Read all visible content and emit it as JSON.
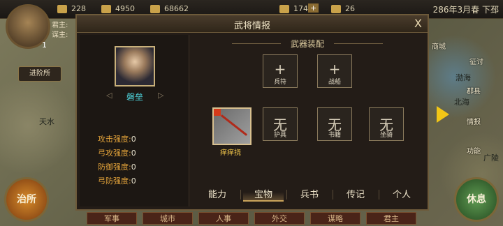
{
  "topbar": {
    "resources": [
      {
        "icon": "gold-icon",
        "value": "228"
      },
      {
        "icon": "grain-icon",
        "value": "4950"
      },
      {
        "icon": "silver-icon",
        "value": "68662"
      },
      {
        "icon": "soldier-icon",
        "value": "174"
      },
      {
        "icon": "plus-icon",
        "value": "+"
      },
      {
        "icon": "order-icon",
        "value": "26"
      }
    ],
    "date": "286年3月春 下邳"
  },
  "lord": {
    "level": "1",
    "title_label": "君主:",
    "strategist_label": "谋主:"
  },
  "promote_label": "进阶所",
  "map": {
    "labels": [
      "天水",
      "渤海",
      "北海",
      "广陵"
    ],
    "buttons": [
      "商城",
      "征讨",
      "郡县",
      "情报",
      "功能"
    ]
  },
  "left_circle": "治所",
  "right_circle": "休息",
  "bottom_menu": [
    "军事",
    "城市",
    "人事",
    "外交",
    "谋略",
    "君主"
  ],
  "dialog": {
    "title": "武将情报",
    "close": "X",
    "general": {
      "name": "磐垒",
      "nav_prev": "◁",
      "nav_next": "▷",
      "stats": [
        {
          "label": "攻击强度:",
          "value": "0"
        },
        {
          "label": "弓攻强度:",
          "value": "0"
        },
        {
          "label": "防御强度:",
          "value": "0"
        },
        {
          "label": "弓防强度:",
          "value": "0"
        }
      ]
    },
    "equip_section": "武器装配",
    "slots_top": [
      {
        "glyph": "+",
        "label": "兵符"
      },
      {
        "glyph": "+",
        "label": "战船"
      }
    ],
    "slots_bottom": [
      {
        "glyph": "无",
        "label": "护具"
      },
      {
        "glyph": "无",
        "label": "书籍"
      },
      {
        "glyph": "无",
        "label": "坐骑"
      }
    ],
    "treasure_name": "痒痒挠",
    "tabs": [
      "能力",
      "宝物",
      "兵书",
      "传记",
      "个人"
    ],
    "active_tab": "宝物"
  }
}
